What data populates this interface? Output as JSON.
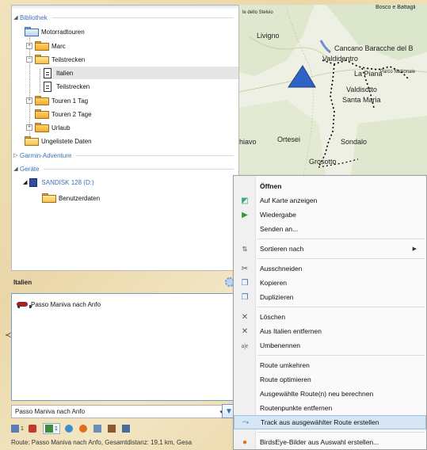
{
  "tree": {
    "bibliothek": "Bibliothek",
    "motorradtouren": "Motorradtouren",
    "marc": "Marc",
    "teilstrecken": "Teilstrecken",
    "italien": "Italien",
    "teilstrecken_child": "Teilstrecken",
    "touren1": "Touren 1 Tag",
    "touren2": "Touren 2 Tage",
    "urlaub": "Urlaub",
    "ungelistete": "Ungelistete Daten",
    "garmin": "Garmin-Adventure",
    "geraete": "Geräte",
    "sandisk": "SANDISK 128 (D:)",
    "benutzerdaten": "Benutzerdaten"
  },
  "map": {
    "labels": {
      "livigno": "Livigno",
      "cancano": "Cancano Baracche del B",
      "valdidentro": "Valdidentro",
      "la_piana": "La Piana",
      "parco": "Parco Nazionale",
      "valdisotto": "Valdisotto",
      "santa_maria": "Santa Maria",
      "ortesei": "Ortesei",
      "chiavo": "hiavo",
      "sondalo": "Sondalo",
      "grosotto": "Grosotto",
      "top_left": "le dello Stelvio",
      "top_right": "Bosco e Battagli"
    }
  },
  "panel": {
    "title": "Italien",
    "route_item": "Passo Maniva nach Anfo",
    "dropdown_value": "Passo Maniva nach Anfo",
    "tb_count1": "1",
    "tb_count2": "1"
  },
  "status": {
    "text": "Route: Passo Maniva nach Anfo, Gesamtdistanz: 19,1 km, Gesa"
  },
  "context_menu": {
    "oeffnen": "Öffnen",
    "auf_karte": "Auf Karte anzeigen",
    "wiedergabe": "Wiedergabe",
    "senden": "Senden an...",
    "sortieren": "Sortieren nach",
    "ausschneiden": "Ausschneiden",
    "kopieren": "Kopieren",
    "duplizieren": "Duplizieren",
    "loeschen": "Löschen",
    "aus_italien": "Aus Italien entfernen",
    "umbenennen": "Umbenennen",
    "route_umkehren": "Route umkehren",
    "route_optimieren": "Route optimieren",
    "neu_berechnen": "Ausgewählte Route(n) neu berechnen",
    "routenpunkte": "Routenpunkte entfernen",
    "track_erstellen": "Track aus ausgewählter Route erstellen",
    "birdseye": "BirdsEye-Bilder aus Auswahl erstellen..."
  },
  "colors": {
    "selection_highlight": "#d7e6f5",
    "section_link": "#3b72b8",
    "position_marker": "#2f63c4"
  }
}
